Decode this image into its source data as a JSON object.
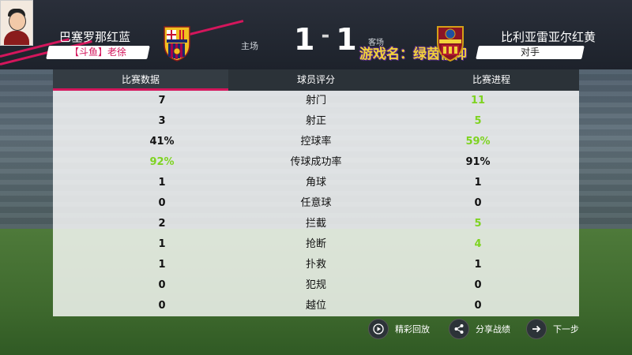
{
  "header": {
    "home_team": "巴塞罗那红蓝",
    "home_player_tag": "【斗鱼】老徐",
    "home_label": "主场",
    "score_home": "1",
    "score_sep": "-",
    "score_away": "1",
    "away_label": "客场",
    "away_team": "比利亚雷亚尔红黄",
    "away_player_tag": "对手",
    "watermark": "游戏名：绿茵信仰"
  },
  "tabs": [
    {
      "label": "比赛数据",
      "active": true
    },
    {
      "label": "球员评分",
      "active": false
    },
    {
      "label": "比赛进程",
      "active": false
    }
  ],
  "stats": [
    {
      "home": "7",
      "label": "射门",
      "away": "11",
      "winner": "away"
    },
    {
      "home": "3",
      "label": "射正",
      "away": "5",
      "winner": "away"
    },
    {
      "home": "41%",
      "label": "控球率",
      "away": "59%",
      "winner": "away"
    },
    {
      "home": "92%",
      "label": "传球成功率",
      "away": "91%",
      "winner": "home"
    },
    {
      "home": "1",
      "label": "角球",
      "away": "1",
      "winner": "none"
    },
    {
      "home": "0",
      "label": "任意球",
      "away": "0",
      "winner": "none"
    },
    {
      "home": "2",
      "label": "拦截",
      "away": "5",
      "winner": "away"
    },
    {
      "home": "1",
      "label": "抢断",
      "away": "4",
      "winner": "away"
    },
    {
      "home": "1",
      "label": "扑救",
      "away": "1",
      "winner": "none"
    },
    {
      "home": "0",
      "label": "犯规",
      "away": "0",
      "winner": "none"
    },
    {
      "home": "0",
      "label": "越位",
      "away": "0",
      "winner": "none"
    }
  ],
  "bottom": {
    "replay_label": "精彩回放",
    "share_label": "分享战绩",
    "next_label": "下一步"
  },
  "colors": {
    "accent": "#d4165c",
    "winner_green": "#7ed321"
  },
  "icons": {
    "replay": "play-icon",
    "share": "share-icon",
    "next": "arrow-right-icon"
  }
}
